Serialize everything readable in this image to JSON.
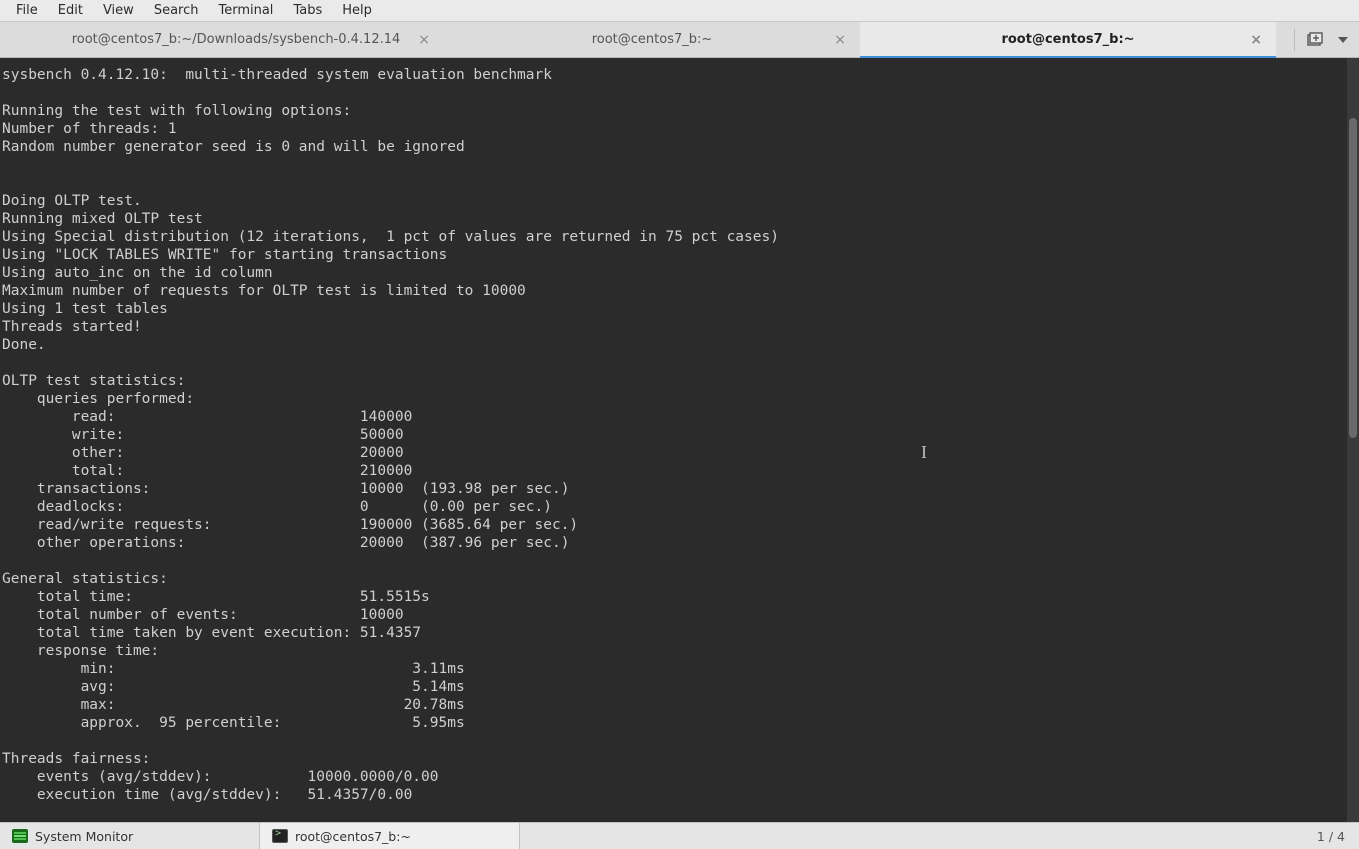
{
  "menu": {
    "items": [
      "File",
      "Edit",
      "View",
      "Search",
      "Terminal",
      "Tabs",
      "Help"
    ]
  },
  "tabs": {
    "items": [
      {
        "label": "root@centos7_b:~/Downloads/sysbench-0.4.12.14",
        "active": false
      },
      {
        "label": "root@centos7_b:~",
        "active": false
      },
      {
        "label": "root@centos7_b:~",
        "active": true
      }
    ]
  },
  "terminal": {
    "output": "sysbench 0.4.12.10:  multi-threaded system evaluation benchmark\n\nRunning the test with following options:\nNumber of threads: 1\nRandom number generator seed is 0 and will be ignored\n\n\nDoing OLTP test.\nRunning mixed OLTP test\nUsing Special distribution (12 iterations,  1 pct of values are returned in 75 pct cases)\nUsing \"LOCK TABLES WRITE\" for starting transactions\nUsing auto_inc on the id column\nMaximum number of requests for OLTP test is limited to 10000\nUsing 1 test tables\nThreads started!\nDone.\n\nOLTP test statistics:\n    queries performed:\n        read:                            140000\n        write:                           50000\n        other:                           20000\n        total:                           210000\n    transactions:                        10000  (193.98 per sec.)\n    deadlocks:                           0      (0.00 per sec.)\n    read/write requests:                 190000 (3685.64 per sec.)\n    other operations:                    20000  (387.96 per sec.)\n\nGeneral statistics:\n    total time:                          51.5515s\n    total number of events:              10000\n    total time taken by event execution: 51.4357\n    response time:\n         min:                                  3.11ms\n         avg:                                  5.14ms\n         max:                                 20.78ms\n         approx.  95 percentile:               5.95ms\n\nThreads fairness:\n    events (avg/stddev):           10000.0000/0.00\n    execution time (avg/stddev):   51.4357/0.00\n"
  },
  "taskbar": {
    "items": [
      {
        "label": "System Monitor"
      },
      {
        "label": "root@centos7_b:~"
      }
    ],
    "workspace": "1 / 4"
  }
}
